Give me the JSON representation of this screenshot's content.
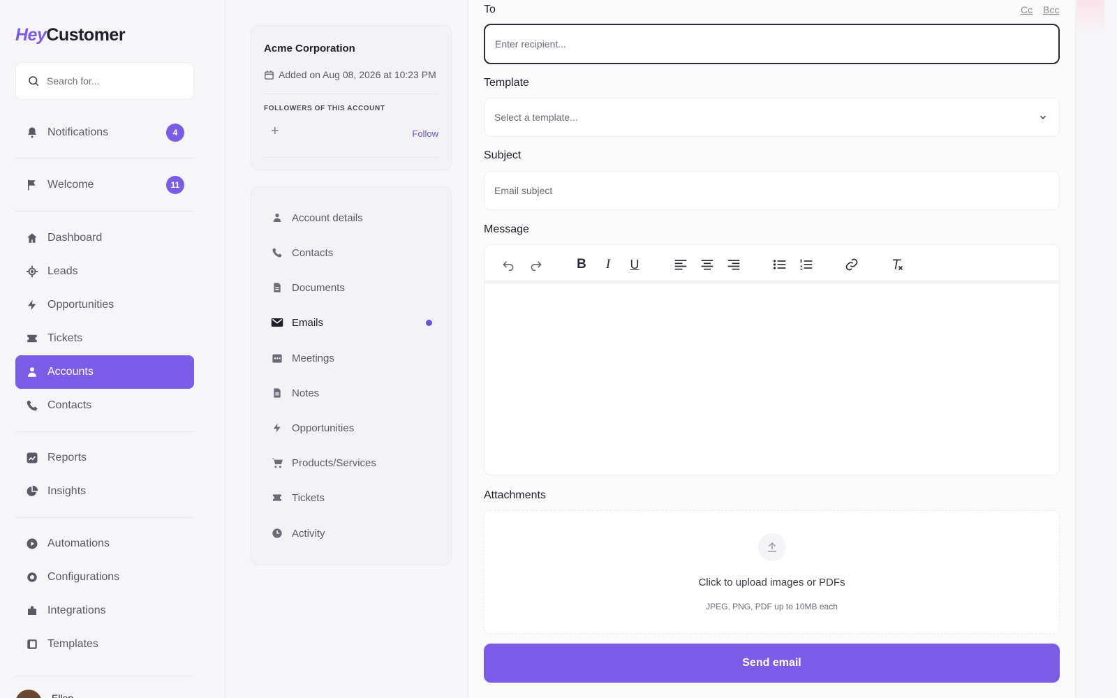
{
  "brand": {
    "hey": "Hey",
    "customer": "Customer"
  },
  "search": {
    "placeholder": "Search for..."
  },
  "sidebar": {
    "notifications": {
      "label": "Notifications",
      "badge": "4"
    },
    "welcome": {
      "label": "Welcome",
      "badge": "11"
    },
    "items": [
      {
        "label": "Dashboard",
        "icon": "home-icon"
      },
      {
        "label": "Leads",
        "icon": "target-icon"
      },
      {
        "label": "Opportunities",
        "icon": "bolt-icon"
      },
      {
        "label": "Tickets",
        "icon": "ticket-icon"
      },
      {
        "label": "Accounts",
        "icon": "user-icon"
      },
      {
        "label": "Contacts",
        "icon": "phone-icon"
      },
      {
        "label": "Reports",
        "icon": "chart-icon"
      },
      {
        "label": "Insights",
        "icon": "pie-icon"
      },
      {
        "label": "Automations",
        "icon": "play-icon"
      },
      {
        "label": "Configurations",
        "icon": "gear-icon"
      },
      {
        "label": "Integrations",
        "icon": "puzzle-icon"
      },
      {
        "label": "Templates",
        "icon": "template-icon"
      }
    ],
    "user": {
      "name": "Ellen"
    }
  },
  "account": {
    "name": "Acme Corporation",
    "added": "Added on Aug 08, 2026 at 10:23 PM",
    "followers_label": "FOLLOWERS OF THIS ACCOUNT",
    "follow": "Follow"
  },
  "subnav": [
    {
      "label": "Account details"
    },
    {
      "label": "Contacts"
    },
    {
      "label": "Documents"
    },
    {
      "label": "Emails"
    },
    {
      "label": "Meetings"
    },
    {
      "label": "Notes"
    },
    {
      "label": "Opportunities"
    },
    {
      "label": "Products/Services"
    },
    {
      "label": "Tickets"
    },
    {
      "label": "Activity"
    }
  ],
  "email": {
    "to_label": "To",
    "cc": "Cc",
    "bcc": "Bcc",
    "to_placeholder": "Enter recipient...",
    "template_label": "Template",
    "template_value": "Select a template...",
    "subject_label": "Subject",
    "subject_placeholder": "Email subject",
    "message_label": "Message",
    "attachments_label": "Attachments",
    "upload_main": "Click to upload images or PDFs",
    "upload_sub": "JPEG, PNG, PDF up to 10MB each",
    "send": "Send email"
  },
  "colors": {
    "accent": "#7b5ce6"
  }
}
